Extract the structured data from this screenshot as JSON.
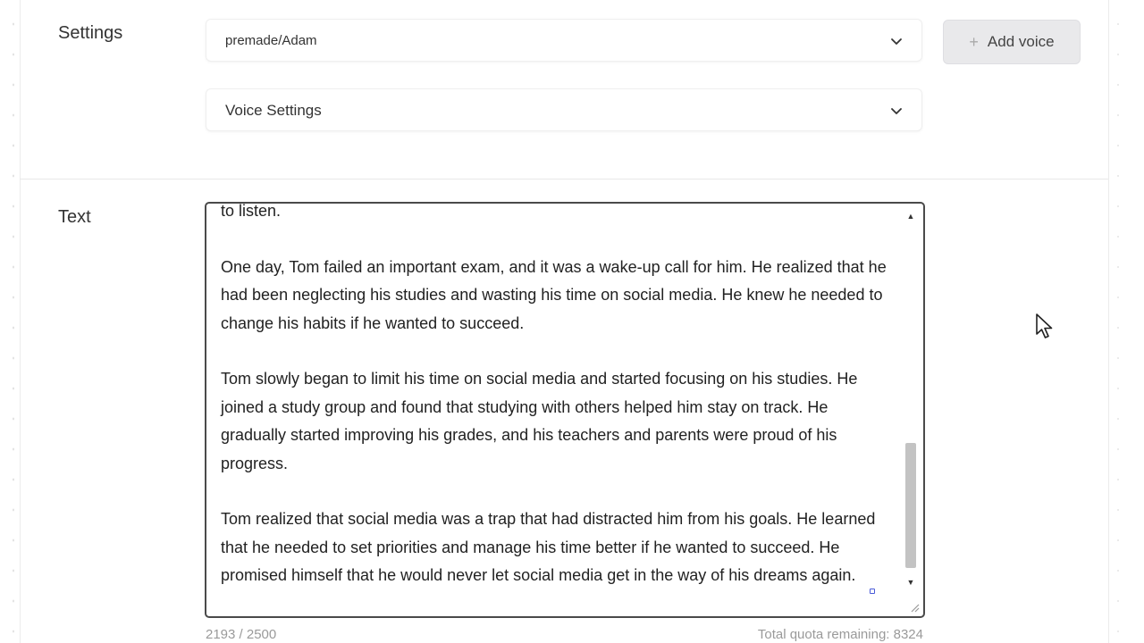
{
  "settings": {
    "label": "Settings",
    "voice_select_value": "premade/Adam",
    "voice_settings_label": "Voice Settings",
    "add_voice_label": "Add voice"
  },
  "text_section": {
    "label": "Text",
    "paragraphs": [
      "to listen.",
      "One day, Tom failed an important exam, and it was a wake-up call for him. He realized that he had been neglecting his studies and wasting his time on social media. He knew he needed to change his habits if he wanted to succeed.",
      "Tom slowly began to limit his time on social media and started focusing on his studies. He joined a study group and found that studying with others helped him stay on track. He gradually started improving his grades, and his teachers and parents were proud of his progress.",
      "Tom realized that social media was a trap that had distracted him from his goals. He learned that he needed to set priorities and manage his time better if he wanted to succeed. He promised himself that he would never let social media get in the way of his dreams again."
    ],
    "char_count": "2193 / 2500",
    "quota": "Total quota remaining: 8324"
  },
  "icons": {
    "chevron": "chevron-down-icon",
    "plus": "plus-icon",
    "cursor": "mouse-pointer-icon"
  }
}
